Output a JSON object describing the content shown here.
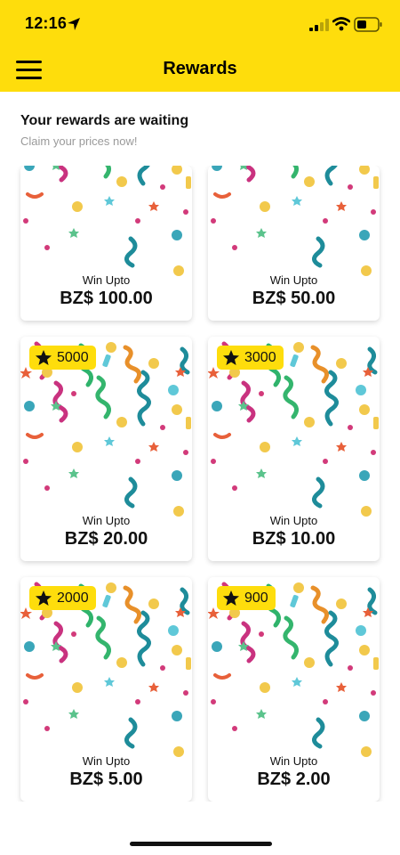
{
  "status": {
    "time": "12:16"
  },
  "header": {
    "title": "Rewards"
  },
  "section": {
    "title": "Your rewards are waiting",
    "subtitle": "Claim your prices now!"
  },
  "rewards": [
    {
      "win_label": "Win Upto",
      "amount": "BZ$ 100.00",
      "points": ""
    },
    {
      "win_label": "Win Upto",
      "amount": "BZ$ 50.00",
      "points": ""
    },
    {
      "win_label": "Win Upto",
      "amount": "BZ$ 20.00",
      "points": "5000"
    },
    {
      "win_label": "Win Upto",
      "amount": "BZ$ 10.00",
      "points": "3000"
    },
    {
      "win_label": "Win Upto",
      "amount": "BZ$ 5.00",
      "points": "2000"
    },
    {
      "win_label": "Win Upto",
      "amount": "BZ$ 2.00",
      "points": "900"
    }
  ],
  "colors": {
    "accent": "#FEDD0C",
    "background": "#FFFFFF",
    "text": "#111111",
    "subtitle": "#9A9A9A"
  },
  "icons": [
    "location-arrow-icon",
    "cellular-signal-icon",
    "wifi-icon",
    "battery-icon",
    "hamburger-menu-icon",
    "star-icon"
  ]
}
